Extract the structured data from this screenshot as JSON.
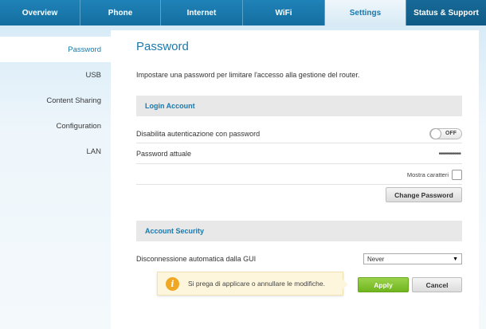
{
  "nav": {
    "tabs": [
      {
        "label": "Overview"
      },
      {
        "label": "Phone"
      },
      {
        "label": "Internet"
      },
      {
        "label": "WiFi"
      },
      {
        "label": "Settings"
      },
      {
        "label": "Status & Support"
      }
    ],
    "active_tab": "Settings"
  },
  "sidebar": {
    "items": [
      {
        "label": "Password"
      },
      {
        "label": "USB"
      },
      {
        "label": "Content Sharing"
      },
      {
        "label": "Configuration"
      },
      {
        "label": "LAN"
      }
    ],
    "active_item": "Password"
  },
  "main": {
    "title": "Password",
    "intro": "Impostare una password per limitare l'accesso alla gestione del router.",
    "login_account": {
      "header": "Login Account",
      "disable_auth_label": "Disabilita autenticazione con password",
      "disable_auth_toggle": "OFF",
      "current_password_label": "Password attuale",
      "current_password_value": "•••••••••••",
      "show_chars_label": "Mostra caratteri",
      "change_password_button": "Change Password"
    },
    "account_security": {
      "header": "Account Security",
      "auto_disconnect_label": "Disconnessione automatica dalla GUI",
      "auto_disconnect_value": "Never"
    }
  },
  "notice": {
    "icon": "info-icon",
    "text": "Si prega di applicare o annullare le modifiche."
  },
  "actions": {
    "apply_label": "Apply",
    "cancel_label": "Cancel"
  },
  "colors": {
    "brand_blue": "#1979ad",
    "apply_green": "#7cc12c",
    "notice_bg": "#fdf6dd",
    "info_orange": "#f0a824"
  }
}
